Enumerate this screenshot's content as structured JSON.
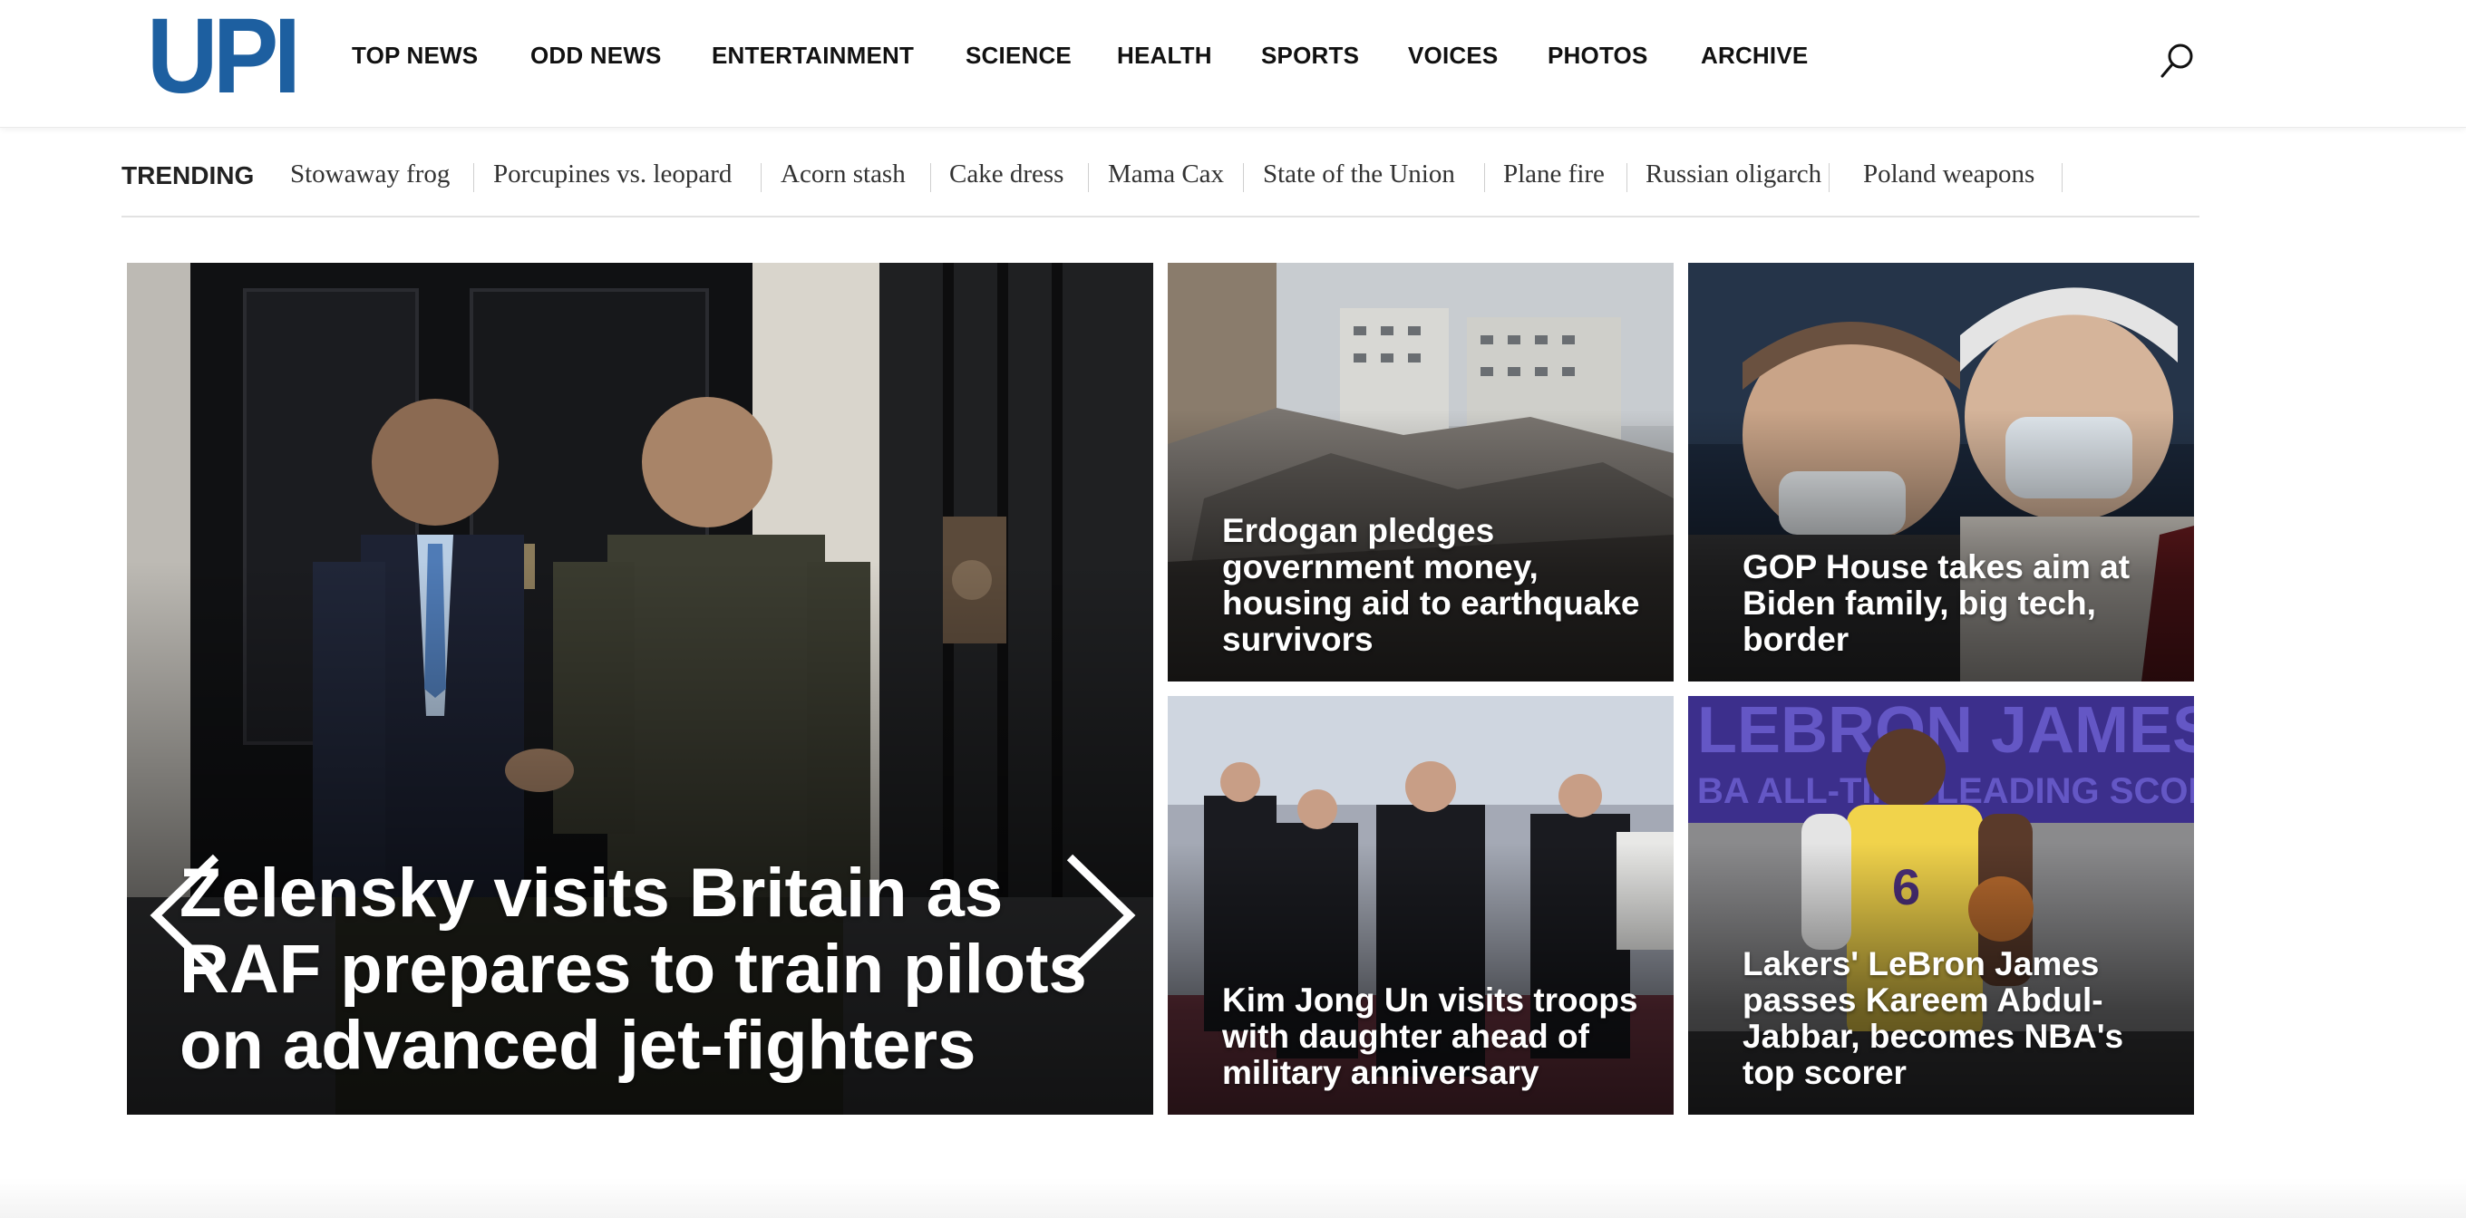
{
  "site": {
    "logo_text": "UPI",
    "brand_color": "#1d5fa0"
  },
  "nav": {
    "items": [
      "TOP NEWS",
      "ODD NEWS",
      "ENTERTAINMENT",
      "SCIENCE",
      "HEALTH",
      "SPORTS",
      "VOICES",
      "PHOTOS",
      "ARCHIVE"
    ],
    "search_icon": "search-icon"
  },
  "trending": {
    "label": "TRENDING",
    "items": [
      "Stowaway frog",
      "Porcupines vs. leopard",
      "Acorn stash",
      "Cake dress",
      "Mama Cax",
      "State of the Union",
      "Plane fire",
      "Russian oligarch",
      "Poland weapons"
    ]
  },
  "featured": {
    "headline": "Zelensky visits Britain as RAF prepares to train pilots on advanced jet-fighters",
    "prev_icon": "chevron-left-icon",
    "next_icon": "chevron-right-icon"
  },
  "stories": [
    {
      "headline": "Erdogan pledges government money, housing aid to earthquake survivors"
    },
    {
      "headline": "GOP House takes aim at Biden family, big tech, border"
    },
    {
      "headline": "Kim Jong Un visits troops with daughter ahead of military anniversary"
    },
    {
      "headline": "Lakers' LeBron James passes Kareem Abdul-Jabbar, becomes NBA's top scorer"
    }
  ]
}
